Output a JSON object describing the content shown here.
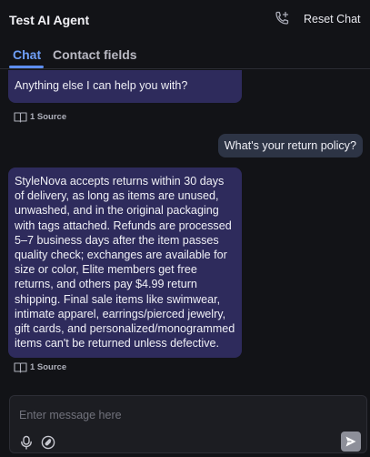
{
  "header": {
    "title": "Test AI Agent",
    "call_icon": "phone-plus-icon",
    "reset_label": "Reset Chat"
  },
  "tabs": [
    {
      "label": "Chat",
      "active": true
    },
    {
      "label": "Contact fields",
      "active": false
    }
  ],
  "messages": [
    {
      "role": "agent",
      "text": "Anything else I can help you with?",
      "source_label": "1 Source"
    },
    {
      "role": "user",
      "text": "What's your return policy?"
    },
    {
      "role": "agent",
      "text": "StyleNova accepts returns within 30 days of delivery, as long as items are unused, unwashed, and in the original packaging with tags attached. Refunds are processed 5–7 business days after the item passes quality check; exchanges are available for size or color, Elite members get free returns, and others pay $4.99 return shipping. Final sale items like swimwear, intimate apparel, earrings/pierced jewelry, gift cards, and personalized/monogrammed items can't be returned unless defective.",
      "source_label": "1 Source"
    }
  ],
  "composer": {
    "placeholder": "Enter message here",
    "value": "",
    "icons": [
      "microphone-icon",
      "link-icon",
      "send-icon"
    ]
  },
  "colors": {
    "accent": "#5d8ef0",
    "agent_bubble": "#2e2b5c",
    "user_bubble": "#2d3445",
    "background": "#121317"
  }
}
